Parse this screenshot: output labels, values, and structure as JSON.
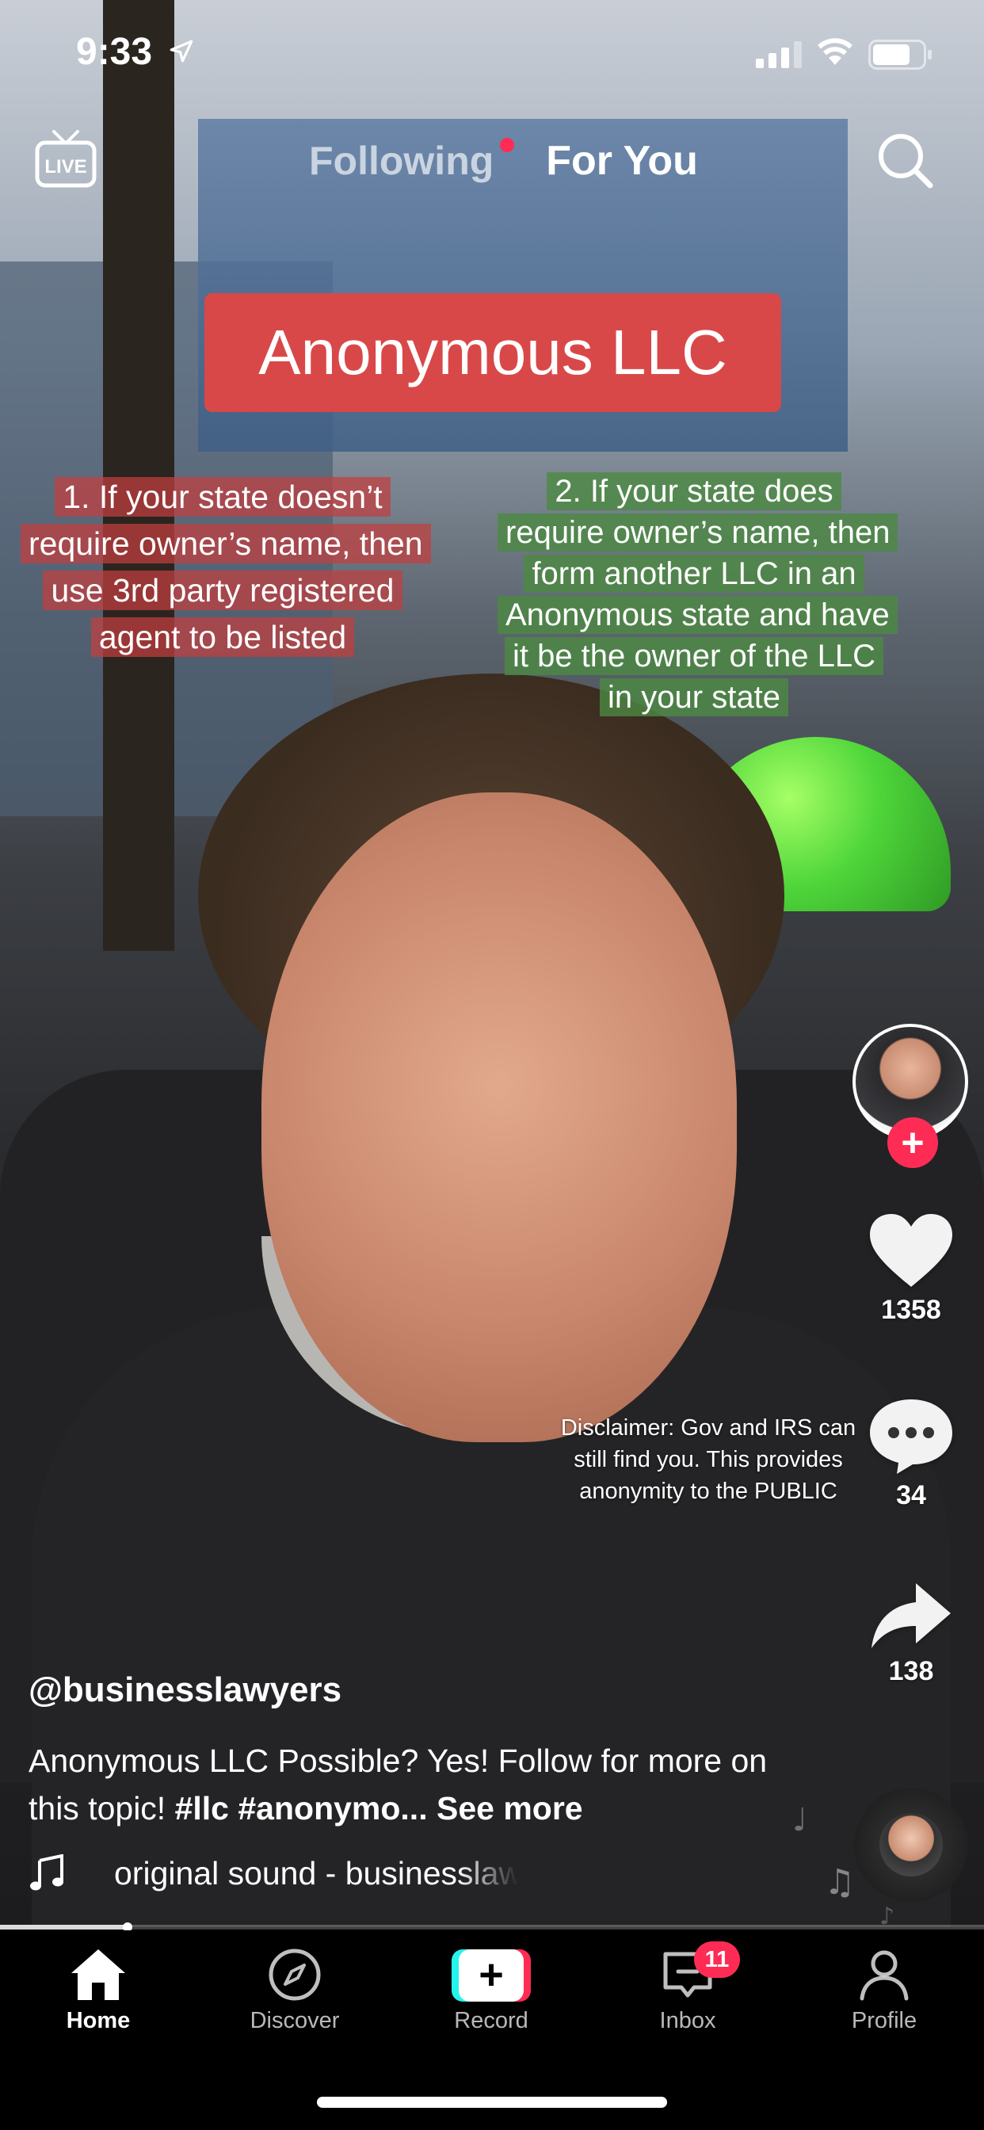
{
  "status_bar": {
    "time": "9:33",
    "icons": [
      "location-arrow-icon",
      "cellular-signal-icon",
      "wifi-icon",
      "battery-icon"
    ]
  },
  "top_nav": {
    "live_label": "LIVE",
    "tabs": [
      {
        "label": "Following",
        "active": false,
        "has_dot": true
      },
      {
        "label": "For You",
        "active": true
      }
    ],
    "search_icon": "search-icon"
  },
  "video_overlay": {
    "title": "Anonymous LLC",
    "caption_left": "1. If your state doesn’t require owner’s name, then use 3rd party registered agent to be listed",
    "caption_right": "2. If your state does require owner’s name, then form another LLC in an Anonymous state and have it be the owner of the LLC in your state",
    "disclaimer": "Disclaimer: Gov and IRS can still find you. This provides anonymity to the PUBLIC",
    "colors": {
      "title_bg": "#d94848",
      "left_bg": "#c43e3e",
      "right_bg": "#4c8a42"
    }
  },
  "actions": {
    "like_count": "1358",
    "comment_count": "34",
    "share_count": "138",
    "follow_symbol": "+"
  },
  "post": {
    "username": "@businesslawyers",
    "description": "Anonymous LLC Possible? Yes! Follow for more on this topic! ",
    "hashtags": "#llc #anonymo...",
    "see_more": " See more",
    "sound": "original sound - businesslawyers"
  },
  "progress": {
    "fraction": 0.13
  },
  "bottom_nav": {
    "tabs": [
      {
        "label": "Home",
        "icon": "home-icon",
        "active": true
      },
      {
        "label": "Discover",
        "icon": "compass-icon"
      },
      {
        "label": "Record",
        "icon": "plus-icon"
      },
      {
        "label": "Inbox",
        "icon": "inbox-icon",
        "badge": "11"
      },
      {
        "label": "Profile",
        "icon": "profile-icon"
      }
    ]
  },
  "theme": {
    "accent": "#fe2c55",
    "record_cyan": "#25f4ee"
  }
}
